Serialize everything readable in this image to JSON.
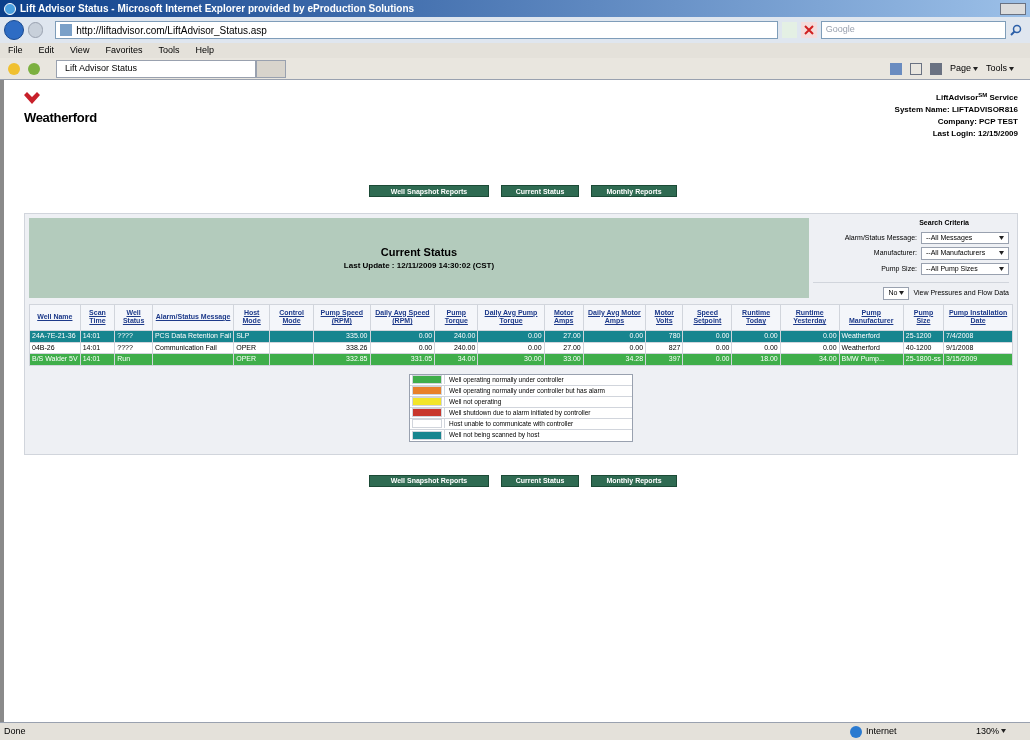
{
  "window": {
    "title": "Lift Advisor Status - Microsoft Internet Explorer provided by eProduction Solutions"
  },
  "address_bar": {
    "url": "http://liftadvisor.com/LiftAdvisor_Status.asp",
    "search_placeholder": "Google"
  },
  "menu": [
    "File",
    "Edit",
    "View",
    "Favorites",
    "Tools",
    "Help"
  ],
  "tabs": [
    {
      "label": "Lift Advisor Status",
      "selected": true
    }
  ],
  "command_bar": [
    "Page",
    "Tools"
  ],
  "header": {
    "logo": "Weatherford",
    "service": "LiftAdvisor$^{SM}$ Service",
    "lines": [
      "System Name: LIFTADVISOR816",
      "Company: PCP TEST",
      "Last Login: 12/15/2009"
    ]
  },
  "nav_buttons_top": [
    "Well Snapshot Reports",
    "Current Status",
    "Monthly Reports"
  ],
  "status_panel": {
    "title": "Current Status",
    "last_update": "Last Update : 12/11/2009 14:30:02 (CST)"
  },
  "search_criteria": {
    "title": "Search Criteria",
    "filters": [
      {
        "label": "Alarm/Status Message:",
        "value": "--All Messages"
      },
      {
        "label": "Manufacturer:",
        "value": "--All Manufacturers"
      },
      {
        "label": "Pump Size:",
        "value": "--All Pump Sizes"
      }
    ],
    "view_option": {
      "value": "No",
      "label": "View Pressures and Flow Data"
    }
  },
  "table": {
    "columns": [
      "Well Name",
      "Scan Time",
      "Well Status",
      "Alarm/Status Message",
      "Host Mode",
      "Control Mode",
      "Pump Speed (RPM)",
      "Daily Avg Speed (RPM)",
      "Pump Torque",
      "Daily Avg Pump Torque",
      "Motor Amps",
      "Daily Avg Motor Amps",
      "Motor Volts",
      "Speed Setpoint",
      "Runtime Today",
      "Runtime Yesterday",
      "Pump Manufacturer",
      "Pump Size",
      "Pump Installation Date"
    ],
    "rows": [
      {
        "color": "#17858f",
        "cells": [
          "24A-7E-21-36",
          "14:01",
          "????",
          "PCS Data Retention Fail",
          "SLP",
          "",
          "335.00",
          "0.00",
          "240.00",
          "0.00",
          "27.00",
          "0.00",
          "780",
          "0.00",
          "0.00",
          "0.00",
          "Weatherford",
          "25-1200",
          "7/4/2008"
        ]
      },
      {
        "color": "#ffffff",
        "cells": [
          "04B-26",
          "14:01",
          "????",
          "Communication Fail",
          "OPER",
          "",
          "338.26",
          "0.00",
          "240.00",
          "0.00",
          "27.00",
          "0.00",
          "827",
          "0.00",
          "0.00",
          "0.00",
          "Weatherford",
          "40-1200",
          "9/1/2008"
        ]
      },
      {
        "color": "#3fae4a",
        "cells": [
          "B/S Walder 5V",
          "14:01",
          "Run",
          "",
          "OPER",
          "",
          "332.85",
          "331.05",
          "34.00",
          "30.00",
          "33.00",
          "34.28",
          "397",
          "0.00",
          "18.00",
          "34.00",
          "BMW Pump...",
          "25-1800-ss",
          "3/15/2009"
        ]
      }
    ]
  },
  "legend": [
    {
      "color": "#3fae4a",
      "label": "Well operating normally under controller"
    },
    {
      "color": "#e8812a",
      "label": "Well operating normally under controller but has alarm"
    },
    {
      "color": "#f2e52a",
      "label": "Well not operating"
    },
    {
      "color": "#c8372d",
      "label": "Well shutdown due to alarm initiated by controller"
    },
    {
      "color": "#ffffff",
      "label": "Host unable to communicate with controller"
    },
    {
      "color": "#17858f",
      "label": "Well not being scanned by host"
    }
  ],
  "nav_buttons_bottom": [
    "Well Snapshot Reports",
    "Current Status",
    "Monthly Reports"
  ],
  "status_bar": {
    "text": "Done",
    "zone": "Internet",
    "zoom": "130%"
  }
}
